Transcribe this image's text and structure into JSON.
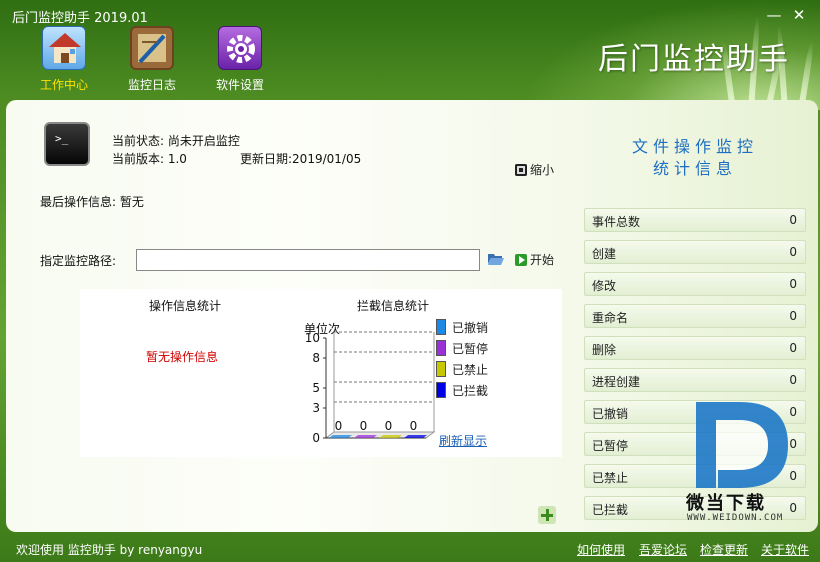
{
  "window": {
    "title": "后门监控助手 2019.01",
    "brand": "后门监控助手",
    "minimize": "—",
    "close": "✕"
  },
  "toolbar": [
    {
      "label": "工作中心",
      "active": true,
      "icon": "house-icon"
    },
    {
      "label": "监控日志",
      "active": false,
      "icon": "log-board-icon"
    },
    {
      "label": "软件设置",
      "active": false,
      "icon": "gear-icon"
    }
  ],
  "info": {
    "status_label": "当前状态: 尚未开启监控",
    "version_label": "当前版本: 1.0",
    "update_label": "更新日期:2019/01/05",
    "minimize_btn": "缩小",
    "last_op": "最后操作信息: 暂无",
    "path_label": "指定监控路径:",
    "path_value": "",
    "start_btn": "开始"
  },
  "stats": {
    "op_title": "操作信息统计",
    "op_empty": "暂无操作信息",
    "block_title": "拦截信息统计",
    "unit": "单位次",
    "refresh": "刷新显示"
  },
  "chart_data": {
    "type": "bar",
    "title": "拦截信息统计",
    "ylabel": "单位次",
    "ylim": [
      0,
      10
    ],
    "yticks": [
      "10",
      "8",
      "5",
      "3",
      "0"
    ],
    "series": [
      {
        "name": "已撤销",
        "value": 0,
        "color": "#1e88e5"
      },
      {
        "name": "已暂停",
        "value": 0,
        "color": "#9b30d9"
      },
      {
        "name": "已禁止",
        "value": 0,
        "color": "#c8c800"
      },
      {
        "name": "已拦截",
        "value": 0,
        "color": "#0000e6"
      }
    ]
  },
  "right": {
    "title_line1": "文件操作监控",
    "title_line2": "统计信息",
    "rows": [
      {
        "label": "事件总数",
        "value": "0"
      },
      {
        "label": "创建",
        "value": "0"
      },
      {
        "label": "修改",
        "value": "0"
      },
      {
        "label": "重命名",
        "value": "0"
      },
      {
        "label": "删除",
        "value": "0"
      },
      {
        "label": "进程创建",
        "value": "0"
      },
      {
        "label": "已撤销",
        "value": "0"
      },
      {
        "label": "已暂停",
        "value": "0"
      },
      {
        "label": "已禁止",
        "value": "0"
      },
      {
        "label": "已拦截",
        "value": "0"
      }
    ]
  },
  "watermark": {
    "text": "微当下载",
    "url": "WWW.WEIDOWN.COM"
  },
  "statusbar": {
    "welcome": "欢迎使用 监控助手  by  renyangyu",
    "links": [
      "如何使用",
      "吾爱论坛",
      "检查更新",
      "关于软件"
    ]
  }
}
